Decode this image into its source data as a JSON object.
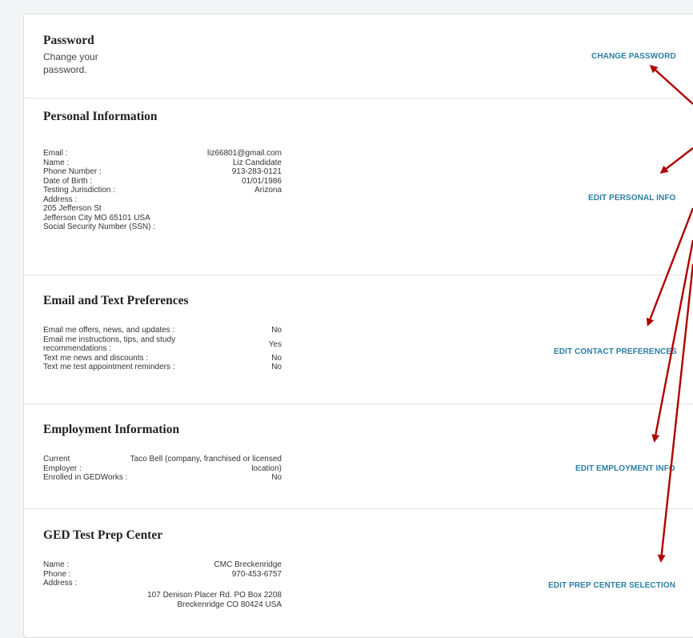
{
  "password": {
    "title": "Password",
    "subtitle": "Change your password.",
    "action": "CHANGE PASSWORD"
  },
  "personal": {
    "title": "Personal Information",
    "action": "EDIT PERSONAL INFO",
    "email_label": "Email :",
    "email_value": "liz66801@gmail.com",
    "name_label": "Name :",
    "name_value": "Liz Candidate",
    "phone_label": "Phone Number :",
    "phone_value": "913-283-0121",
    "dob_label": "Date of Birth :",
    "dob_value": "01/01/1986",
    "jurisdiction_label": "Testing Jurisdiction :",
    "jurisdiction_value": "Arizona",
    "address_label": "Address :",
    "address_line1": "205 Jefferson St",
    "address_line2": "Jefferson City MO 65101 USA",
    "ssn_label": "Social Security Number (SSN) :"
  },
  "preferences": {
    "title": "Email and Text Preferences",
    "action": "EDIT CONTACT PREFERENCES",
    "offers_label": "Email me offers, news, and updates :",
    "offers_value": "No",
    "instructions_label_1": "Email me instructions, tips, and study",
    "instructions_label_2": "recommendations :",
    "instructions_value": "Yes",
    "text_news_label": "Text me news and discounts :",
    "text_news_value": "No",
    "reminders_label": "Text me test appointment reminders :",
    "reminders_value": "No"
  },
  "employment": {
    "title": "Employment Information",
    "action": "EDIT EMPLOYMENT INFO",
    "employer_label_1": "Current",
    "employer_label_2": "Employer :",
    "employer_value_1": "Taco Bell (company, franchised or licensed",
    "employer_value_2": "location)",
    "gedworks_label": "Enrolled in GEDWorks :",
    "gedworks_value": "No"
  },
  "prep_center": {
    "title": "GED Test Prep Center",
    "action": "EDIT PREP CENTER SELECTION",
    "name_label": "Name :",
    "name_value": "CMC Breckenridge",
    "phone_label": "Phone :",
    "phone_value": "970-453-6757",
    "address_label": "Address :",
    "address_line1": "107 Denison Placer Rd. PO Box 2208",
    "address_line2": "Breckenridge CO 80424 USA"
  },
  "colors": {
    "accent": "#2a7ea3",
    "arrow": "#b00000"
  }
}
